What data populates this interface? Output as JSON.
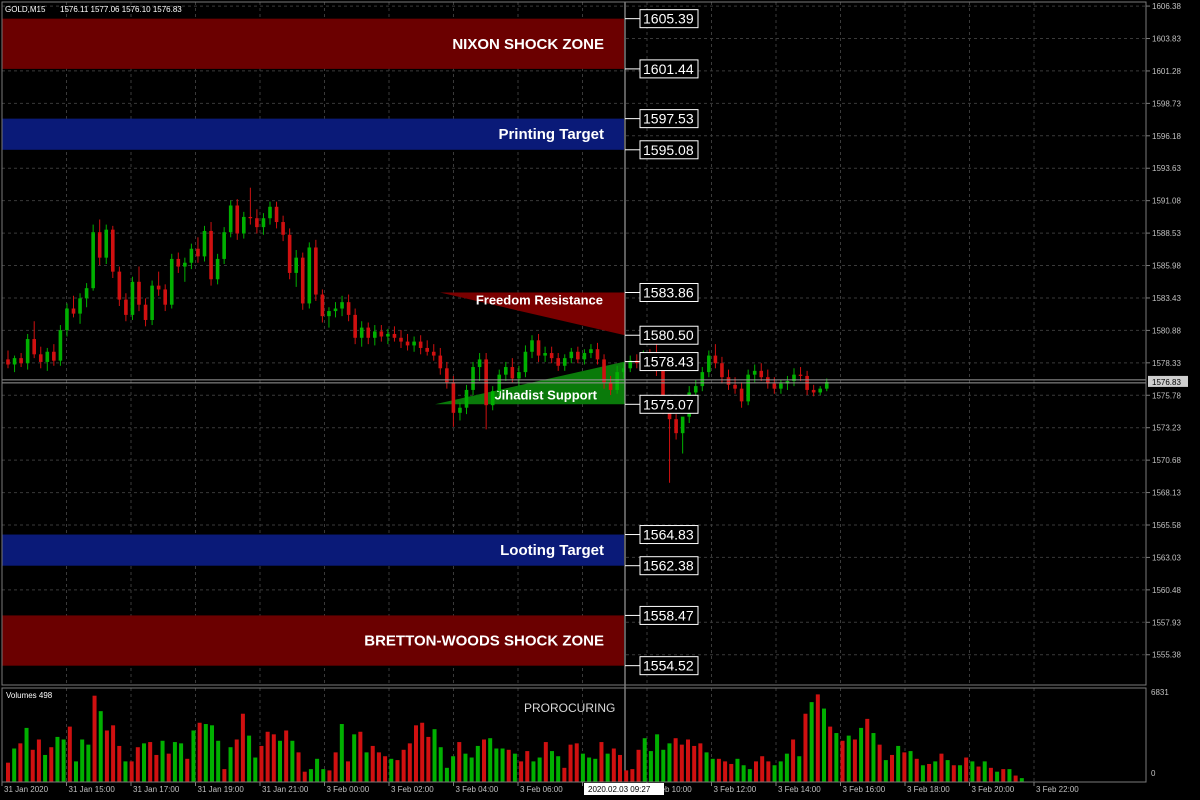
{
  "header": {
    "symbol": "GOLD,M15",
    "ohlc": "1576.11 1577.06 1576.10 1576.83"
  },
  "volume_panel": {
    "label": "Volumes 498",
    "max_label": "6831",
    "zero_label": "0",
    "annotation": "PROROCURING"
  },
  "crosshair": {
    "time_label": "2020.02.03 09:27",
    "current_price_label": "1576.83"
  },
  "colors": {
    "background": "#000000",
    "grid": "#3a3a3a",
    "bull": "#00b000",
    "bear": "#d01010",
    "shock_zone": "#6b0000",
    "target_zone": "#0a1a78",
    "resistance_triangle": "#7a0000",
    "support_triangle": "#0a7a0a"
  },
  "chart_data": {
    "type": "candlestick",
    "symbol": "GOLD",
    "timeframe": "M15",
    "y_axis_ticks": [
      1606.38,
      1603.83,
      1601.28,
      1598.73,
      1596.18,
      1593.63,
      1591.08,
      1588.53,
      1585.98,
      1583.43,
      1580.88,
      1578.33,
      1575.78,
      1573.23,
      1570.68,
      1568.13,
      1565.58,
      1563.03,
      1560.48,
      1557.93,
      1555.38
    ],
    "ylim": [
      1553.0,
      1606.7
    ],
    "x_axis_labels": [
      "31 Jan 2020",
      "31 Jan 15:00",
      "31 Jan 17:00",
      "31 Jan 19:00",
      "31 Jan 21:00",
      "3 Feb 00:00",
      "3 Feb 02:00",
      "3 Feb 04:00",
      "3 Feb 06:00",
      "3 Feb 08:00",
      "3 Feb 10:00",
      "3 Feb 12:00",
      "3 Feb 14:00",
      "3 Feb 16:00",
      "3 Feb 18:00",
      "3 Feb 20:00",
      "3 Feb 22:00"
    ],
    "current_price": 1576.83,
    "zones": [
      {
        "name": "NIXON SHOCK ZONE",
        "type": "shock",
        "top": 1605.39,
        "bottom": 1601.44
      },
      {
        "name": "Printing Target",
        "type": "target",
        "top": 1597.53,
        "bottom": 1595.08
      },
      {
        "name": "Looting Target",
        "type": "target",
        "top": 1564.83,
        "bottom": 1562.38
      },
      {
        "name": "BRETTON-WOODS SHOCK ZONE",
        "type": "shock",
        "top": 1558.47,
        "bottom": 1554.52
      }
    ],
    "triangles": [
      {
        "name": "Freedom Resistance",
        "type": "resistance",
        "apex_price": 1583.86,
        "low_price": 1580.5
      },
      {
        "name": "Jihadist Support",
        "type": "support",
        "apex_price": 1578.43,
        "low_price": 1575.07
      }
    ],
    "level_labels": [
      {
        "text": "1605.39",
        "price": 1605.39
      },
      {
        "text": "1601.44",
        "price": 1601.44
      },
      {
        "text": "1597.53",
        "price": 1597.53
      },
      {
        "text": "1595.08",
        "price": 1595.08
      },
      {
        "text": "1583.86",
        "price": 1583.86
      },
      {
        "text": "1580.50",
        "price": 1580.5
      },
      {
        "text": "1578.43",
        "price": 1578.43
      },
      {
        "text": "1575.07",
        "price": 1575.07
      },
      {
        "text": "1564.83",
        "price": 1564.83
      },
      {
        "text": "1562.38",
        "price": 1562.38
      },
      {
        "text": "1558.47",
        "price": 1558.47
      },
      {
        "text": "1554.52",
        "price": 1554.52
      }
    ],
    "candles": [
      [
        1578.6,
        1579.3,
        1577.9,
        1578.2
      ],
      [
        1578.2,
        1578.9,
        1577.6,
        1578.7
      ],
      [
        1578.7,
        1579.1,
        1578.0,
        1578.3
      ],
      [
        1578.3,
        1580.6,
        1577.8,
        1580.2
      ],
      [
        1580.2,
        1581.6,
        1578.7,
        1579.0
      ],
      [
        1579.0,
        1579.6,
        1577.9,
        1578.4
      ],
      [
        1578.4,
        1579.5,
        1577.7,
        1579.2
      ],
      [
        1579.2,
        1579.8,
        1578.1,
        1578.5
      ],
      [
        1578.5,
        1581.3,
        1578.1,
        1580.9
      ],
      [
        1580.9,
        1583.0,
        1580.4,
        1582.6
      ],
      [
        1582.6,
        1583.6,
        1581.9,
        1582.2
      ],
      [
        1582.2,
        1583.8,
        1581.4,
        1583.4
      ],
      [
        1583.4,
        1584.6,
        1582.7,
        1584.2
      ],
      [
        1584.2,
        1589.2,
        1584.0,
        1588.6
      ],
      [
        1588.6,
        1589.6,
        1586.0,
        1586.6
      ],
      [
        1586.6,
        1589.2,
        1586.1,
        1588.8
      ],
      [
        1588.8,
        1589.1,
        1585.0,
        1585.5
      ],
      [
        1585.5,
        1585.9,
        1582.8,
        1583.3
      ],
      [
        1583.3,
        1583.8,
        1581.6,
        1582.1
      ],
      [
        1582.1,
        1585.1,
        1581.7,
        1584.7
      ],
      [
        1584.7,
        1585.9,
        1582.4,
        1582.9
      ],
      [
        1582.9,
        1583.4,
        1581.2,
        1581.7
      ],
      [
        1581.7,
        1584.8,
        1581.3,
        1584.4
      ],
      [
        1584.4,
        1585.5,
        1583.6,
        1584.1
      ],
      [
        1584.1,
        1584.5,
        1582.4,
        1582.9
      ],
      [
        1582.9,
        1586.9,
        1582.6,
        1586.5
      ],
      [
        1586.5,
        1587.0,
        1585.4,
        1585.9
      ],
      [
        1585.9,
        1586.6,
        1584.7,
        1586.2
      ],
      [
        1586.2,
        1587.7,
        1585.7,
        1587.3
      ],
      [
        1587.3,
        1588.2,
        1586.2,
        1586.7
      ],
      [
        1586.7,
        1589.1,
        1586.3,
        1588.7
      ],
      [
        1588.7,
        1589.4,
        1584.4,
        1584.9
      ],
      [
        1584.9,
        1586.9,
        1584.5,
        1586.5
      ],
      [
        1586.5,
        1589.0,
        1586.1,
        1588.6
      ],
      [
        1588.6,
        1591.1,
        1588.2,
        1590.7
      ],
      [
        1590.7,
        1591.2,
        1588.0,
        1588.5
      ],
      [
        1588.5,
        1590.2,
        1588.1,
        1589.8
      ],
      [
        1589.8,
        1592.1,
        1589.2,
        1589.7
      ],
      [
        1589.7,
        1590.4,
        1588.5,
        1589.0
      ],
      [
        1589.0,
        1590.1,
        1588.4,
        1589.7
      ],
      [
        1589.7,
        1591.0,
        1589.2,
        1590.6
      ],
      [
        1590.6,
        1591.0,
        1588.9,
        1589.4
      ],
      [
        1589.4,
        1589.9,
        1587.9,
        1588.4
      ],
      [
        1588.4,
        1588.9,
        1584.9,
        1585.4
      ],
      [
        1585.4,
        1587.2,
        1584.3,
        1586.6
      ],
      [
        1586.6,
        1587.0,
        1582.5,
        1583.0
      ],
      [
        1583.0,
        1587.8,
        1582.6,
        1587.4
      ],
      [
        1587.4,
        1588.0,
        1583.2,
        1583.7
      ],
      [
        1583.7,
        1584.1,
        1581.5,
        1582.0
      ],
      [
        1582.0,
        1582.7,
        1581.1,
        1582.4
      ],
      [
        1582.4,
        1583.1,
        1581.9,
        1582.6
      ],
      [
        1582.6,
        1583.6,
        1582.0,
        1583.1
      ],
      [
        1583.1,
        1583.7,
        1581.6,
        1582.1
      ],
      [
        1582.1,
        1582.6,
        1579.8,
        1580.3
      ],
      [
        1580.3,
        1581.6,
        1579.6,
        1581.1
      ],
      [
        1581.1,
        1581.5,
        1579.8,
        1580.3
      ],
      [
        1580.3,
        1581.3,
        1579.7,
        1580.8
      ],
      [
        1580.8,
        1581.3,
        1580.0,
        1580.4
      ],
      [
        1580.4,
        1581.0,
        1579.8,
        1580.6
      ],
      [
        1580.6,
        1581.2,
        1580.0,
        1580.3
      ],
      [
        1580.3,
        1580.9,
        1579.5,
        1580.0
      ],
      [
        1580.0,
        1580.6,
        1579.3,
        1579.7
      ],
      [
        1579.7,
        1580.4,
        1579.2,
        1580.0
      ],
      [
        1580.0,
        1580.5,
        1579.0,
        1579.5
      ],
      [
        1579.5,
        1580.1,
        1578.9,
        1579.2
      ],
      [
        1579.2,
        1579.8,
        1578.5,
        1578.9
      ],
      [
        1578.9,
        1579.5,
        1577.4,
        1577.9
      ],
      [
        1577.9,
        1578.4,
        1576.3,
        1576.8
      ],
      [
        1576.8,
        1577.3,
        1573.3,
        1574.4
      ],
      [
        1574.4,
        1575.2,
        1573.8,
        1574.8
      ],
      [
        1574.8,
        1576.6,
        1574.3,
        1576.2
      ],
      [
        1576.2,
        1578.4,
        1575.8,
        1578.0
      ],
      [
        1578.0,
        1579.1,
        1576.9,
        1578.6
      ],
      [
        1578.6,
        1579.1,
        1573.1,
        1575.0
      ],
      [
        1575.0,
        1576.5,
        1574.6,
        1576.1
      ],
      [
        1576.1,
        1577.8,
        1575.7,
        1577.4
      ],
      [
        1577.4,
        1578.4,
        1576.9,
        1578.0
      ],
      [
        1578.0,
        1578.7,
        1576.8,
        1577.1
      ],
      [
        1577.1,
        1578.1,
        1576.5,
        1577.6
      ],
      [
        1577.6,
        1579.7,
        1577.2,
        1579.2
      ],
      [
        1579.2,
        1580.5,
        1578.7,
        1580.1
      ],
      [
        1580.1,
        1580.6,
        1578.4,
        1578.9
      ],
      [
        1578.9,
        1579.6,
        1578.4,
        1579.1
      ],
      [
        1579.1,
        1579.6,
        1578.3,
        1578.7
      ],
      [
        1578.7,
        1579.1,
        1577.7,
        1578.1
      ],
      [
        1578.1,
        1579.0,
        1577.7,
        1578.7
      ],
      [
        1578.7,
        1579.5,
        1578.3,
        1579.2
      ],
      [
        1579.2,
        1579.6,
        1578.3,
        1578.6
      ],
      [
        1578.6,
        1579.4,
        1578.2,
        1579.1
      ],
      [
        1579.1,
        1579.8,
        1578.7,
        1579.4
      ],
      [
        1579.4,
        1579.9,
        1578.2,
        1578.6
      ],
      [
        1578.6,
        1579.0,
        1576.3,
        1576.8
      ],
      [
        1576.8,
        1577.3,
        1575.8,
        1576.2
      ],
      [
        1576.2,
        1578.1,
        1575.9,
        1577.6
      ],
      [
        1577.6,
        1578.3,
        1577.1,
        1577.9
      ],
      [
        1577.9,
        1578.9,
        1577.6,
        1578.5
      ],
      [
        1578.5,
        1579.0,
        1577.9,
        1578.3
      ],
      [
        1578.3,
        1579.3,
        1577.8,
        1578.9
      ],
      [
        1578.9,
        1579.4,
        1577.9,
        1578.3
      ],
      [
        1578.3,
        1580.0,
        1577.3,
        1577.7
      ],
      [
        1577.7,
        1578.1,
        1574.3,
        1575.0
      ],
      [
        1575.0,
        1575.4,
        1568.9,
        1573.9
      ],
      [
        1573.9,
        1574.3,
        1572.3,
        1572.8
      ],
      [
        1572.8,
        1573.4,
        1571.2,
        1574.1
      ],
      [
        1574.1,
        1576.5,
        1573.6,
        1576.0
      ],
      [
        1576.0,
        1577.0,
        1575.6,
        1576.5
      ],
      [
        1576.5,
        1578.0,
        1576.1,
        1577.6
      ],
      [
        1577.6,
        1579.3,
        1577.2,
        1578.9
      ],
      [
        1578.9,
        1579.8,
        1577.9,
        1578.3
      ],
      [
        1578.3,
        1578.8,
        1576.7,
        1577.2
      ],
      [
        1577.2,
        1577.8,
        1576.2,
        1576.6
      ],
      [
        1576.6,
        1577.2,
        1575.9,
        1576.3
      ],
      [
        1576.3,
        1576.8,
        1574.8,
        1575.3
      ],
      [
        1575.3,
        1577.8,
        1575.0,
        1577.4
      ],
      [
        1577.4,
        1578.2,
        1576.8,
        1577.7
      ],
      [
        1577.7,
        1578.3,
        1576.9,
        1577.2
      ],
      [
        1577.2,
        1577.8,
        1576.3,
        1576.7
      ],
      [
        1576.7,
        1577.2,
        1575.9,
        1576.3
      ],
      [
        1576.3,
        1577.0,
        1575.9,
        1576.7
      ],
      [
        1576.7,
        1577.3,
        1576.2,
        1576.9
      ],
      [
        1576.9,
        1577.9,
        1576.5,
        1577.4
      ],
      [
        1577.4,
        1578.0,
        1576.9,
        1577.3
      ],
      [
        1577.3,
        1577.7,
        1575.8,
        1576.2
      ],
      [
        1576.2,
        1576.6,
        1575.7,
        1576.0
      ],
      [
        1576.0,
        1576.5,
        1575.8,
        1576.3
      ],
      [
        1576.3,
        1577.1,
        1576.1,
        1576.83
      ]
    ],
    "volumes": [
      1500,
      2600,
      3000,
      4200,
      2500,
      3300,
      2100,
      2700,
      3500,
      3300,
      4300,
      1600,
      3300,
      2900,
      6700,
      5500,
      4000,
      4400,
      2800,
      1600,
      1600,
      2700,
      3000,
      3100,
      2100,
      3200,
      2200,
      3100,
      3000,
      1800,
      4000,
      4600,
      4500,
      4400,
      3200,
      1000,
      2700,
      3300,
      5300,
      3600,
      1900,
      2800,
      3900,
      3700,
      3200,
      4000,
      3200,
      2300,
      800,
      1000,
      1800,
      1000,
      900,
      2300,
      4500,
      1600,
      3700,
      3900,
      2300,
      2800,
      2300,
      2000,
      1800,
      1700,
      2500,
      3000,
      4400,
      4600,
      3500,
      4100,
      2700,
      1100,
      2000,
      3100,
      2200,
      1900,
      2800,
      3300,
      3400,
      2600,
      2600,
      2500,
      2200,
      1600,
      2400,
      1600,
      1900,
      3100,
      2400,
      2000,
      1100,
      2900,
      3000,
      2200,
      1900,
      1800,
      3100,
      2200,
      2600,
      2100,
      900,
      1000,
      2500,
      3400,
      2400,
      3700,
      2500,
      3000,
      3400,
      2900,
      3300,
      2800,
      3000,
      2300,
      1800,
      1800,
      1600,
      1400,
      1800,
      1300,
      1000,
      1600,
      2000,
      1600,
      1300,
      1600,
      2200,
      3300,
      2000,
      5300,
      6200,
      6800,
      5700,
      4300,
      3800,
      3200,
      3600,
      3300,
      4200,
      4900,
      3800,
      2900,
      1700,
      2100,
      2800,
      2300,
      2400,
      1800,
      1300,
      1400,
      1600,
      2200,
      1700,
      1300,
      1300,
      1900,
      1600,
      1200,
      1600,
      1100,
      800,
      1000,
      1000,
      500,
      300
    ],
    "ylim_volume": [
      0,
      6831
    ]
  }
}
